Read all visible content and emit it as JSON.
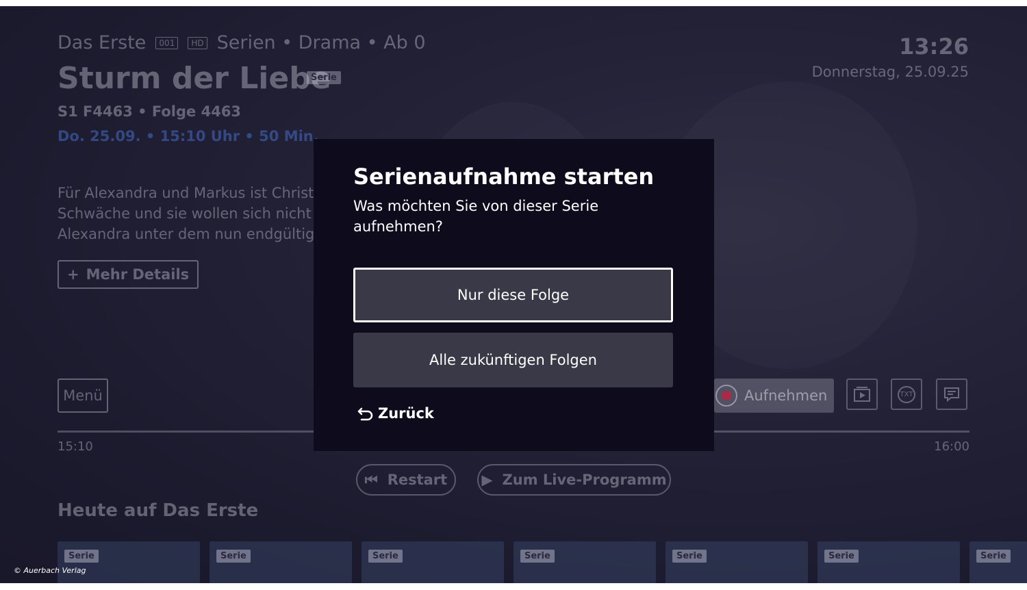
{
  "background": {
    "channel": "Das Erste",
    "channel_number": "001",
    "quality": "HD",
    "genre_line": "Serien • Drama • Ab 0",
    "title": "Sturm der Liebe",
    "title_badge": "Serie",
    "episode": "S1 F4463 • Folge 4463",
    "airtime": "Do. 25.09. • 15:10 Uhr • 50 Min.",
    "description": "Für Alexandra und Markus ist Christ Schwäche und sie wollen sich nicht Alexandra unter dem nun endgültig",
    "more_details_label": "Mehr Details",
    "clock": "13:26",
    "date": "Donnerstag, 25.09.25",
    "menu_label": "Menü",
    "record_label": "Aufnehmen",
    "txt_label": "TXT",
    "time_start": "15:10",
    "time_end": "16:00",
    "restart_label": "Restart",
    "live_label": "Zum Live-Programm",
    "section_title": "Heute auf Das Erste",
    "tiles": [
      "Serie",
      "Serie",
      "Serie",
      "Serie",
      "Serie",
      "Serie",
      "Serie"
    ]
  },
  "dialog": {
    "title": "Serienaufnahme starten",
    "question": "Was möchten Sie von dieser Serie aufnehmen?",
    "option_1": "Nur diese Folge",
    "option_2": "Alle zukünftigen Folgen",
    "back_label": "Zurück"
  },
  "copyright": "© Auerbach Verlag",
  "colors": {
    "dialog_bg": "#0e0c1c",
    "button_bg": "#3a3948",
    "focus_border": "#ffffff",
    "record_red": "#c81e3c"
  }
}
